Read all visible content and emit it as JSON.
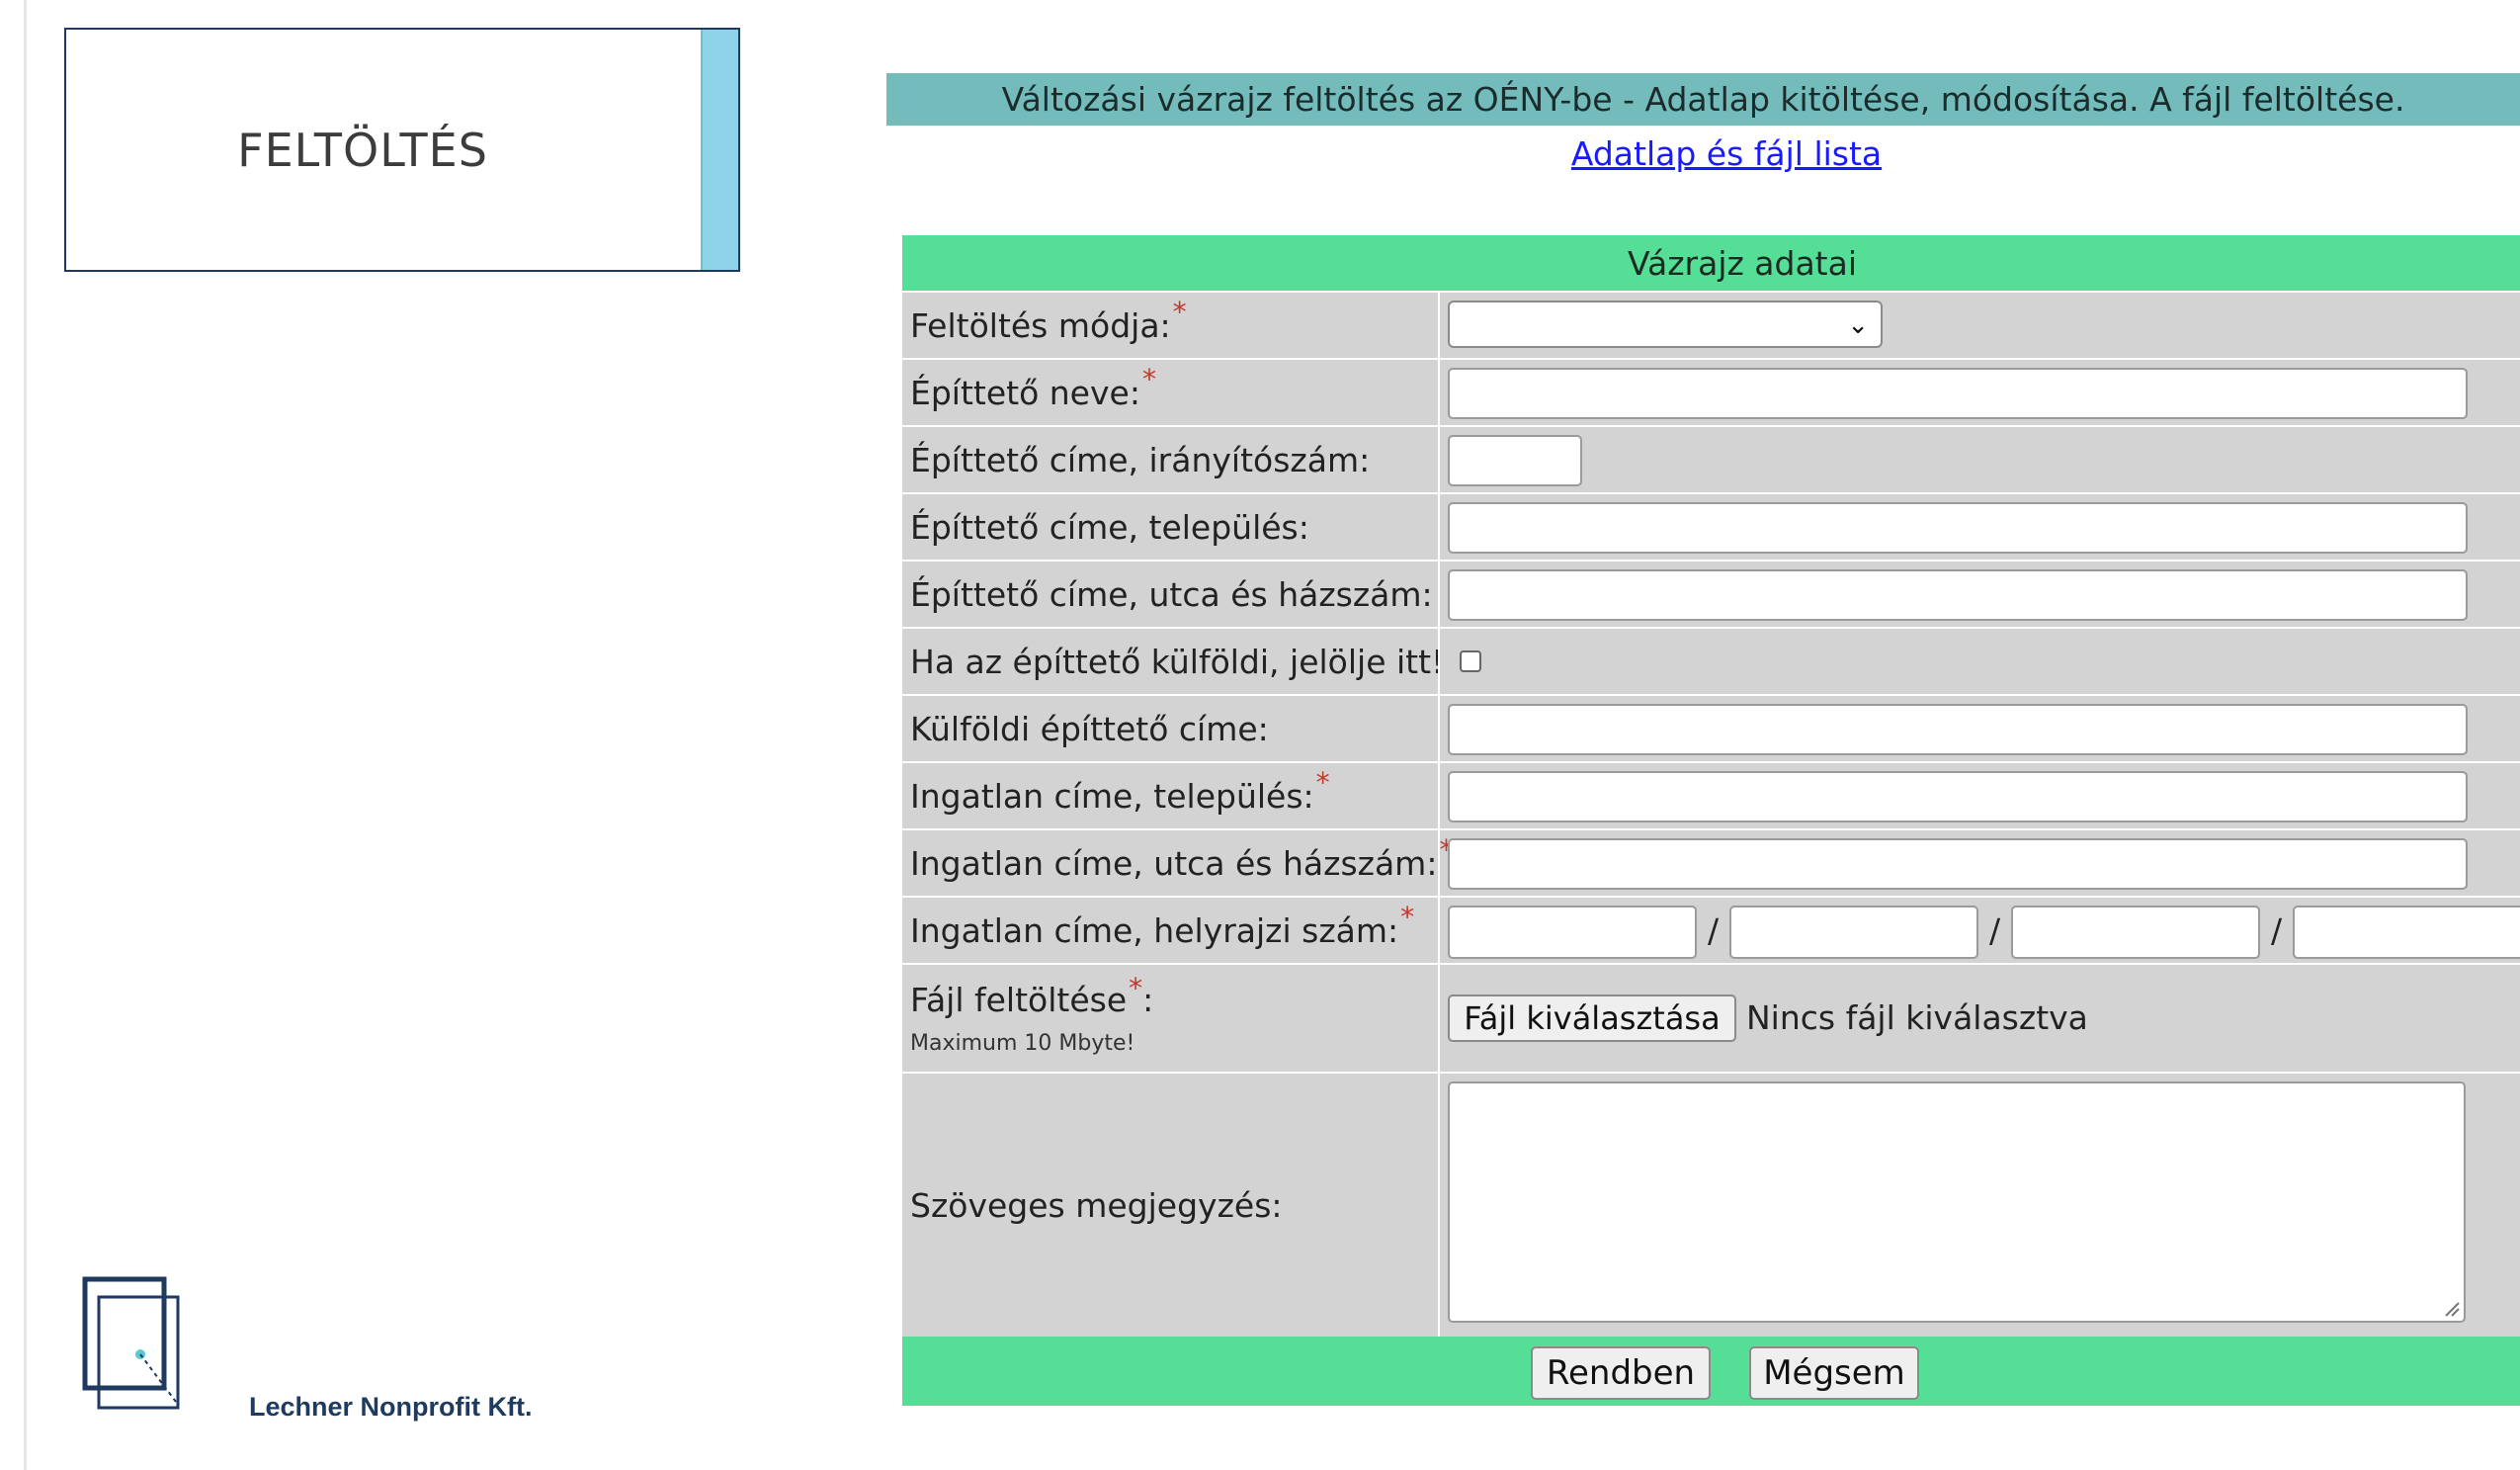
{
  "sidebar": {
    "tile_title": "FELTÖLTÉS",
    "company": "Lechner Nonprofit Kft."
  },
  "header": {
    "banner": "Változási vázrajz feltöltés az OÉNY-be - Adatlap kitöltése, módosítása. A fájl feltöltése.",
    "link": "Adatlap és fájl lista"
  },
  "form": {
    "title": "Vázrajz adatai",
    "fields": {
      "upload_mode": {
        "label": "Feltöltés módja:",
        "required": "*",
        "value": ""
      },
      "builder_name": {
        "label": "Építtető neve:",
        "required": "*",
        "value": ""
      },
      "builder_zip": {
        "label": "Építtető címe, irányítószám:",
        "value": ""
      },
      "builder_city": {
        "label": "Építtető címe, település:",
        "value": ""
      },
      "builder_street": {
        "label": "Építtető címe, utca és házszám:",
        "value": ""
      },
      "foreign_flag": {
        "label": "Ha az építtető külföldi, jelölje itt!",
        "checked": false
      },
      "foreign_address": {
        "label": "Külföldi építtető címe:",
        "value": ""
      },
      "property_city": {
        "label": "Ingatlan címe, település:",
        "required": "*",
        "value": ""
      },
      "property_street": {
        "label": "Ingatlan címe, utca és házszám:",
        "required": "*",
        "value": ""
      },
      "property_lot": {
        "label": "Ingatlan címe, helyrajzi szám:",
        "required": "*",
        "separator": "/",
        "values": [
          "",
          "",
          "",
          ""
        ]
      },
      "file": {
        "label": "Fájl feltöltése",
        "required": "*",
        "suffix": ":",
        "note": "Maximum 10 Mbyte!",
        "button": "Fájl kiválasztása",
        "status": "Nincs fájl kiválasztva"
      },
      "comment": {
        "label": "Szöveges megjegyzés:",
        "value": ""
      }
    },
    "buttons": {
      "ok": "Rendben",
      "cancel": "Mégsem"
    }
  }
}
